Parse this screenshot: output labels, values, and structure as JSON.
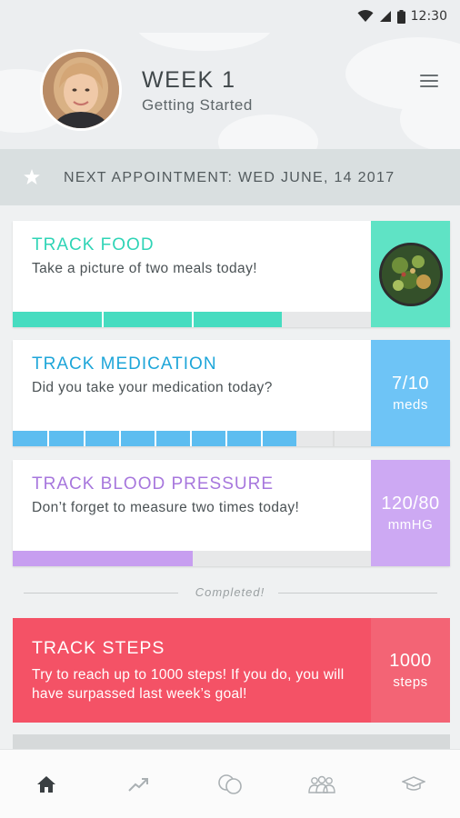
{
  "status_bar": {
    "time": "12:30",
    "icons": [
      "wifi-icon",
      "signal-icon",
      "battery-icon"
    ]
  },
  "header": {
    "week_title": "WEEK 1",
    "week_subtitle": "Getting Started",
    "menu_icon": "hamburger-menu-icon"
  },
  "appointment": {
    "icon": "star-icon",
    "text": "NEXT APPOINTMENT: WED JUNE, 14 2017"
  },
  "cards": [
    {
      "title": "TRACK FOOD",
      "description": "Take a picture of two meals today!",
      "accent": "#3ddbbf",
      "side_color": "#5fe3c5",
      "progress": {
        "segments": 4,
        "filled": 3,
        "fraction": 0.75
      }
    },
    {
      "title": "TRACK MEDICATION",
      "description": "Did you take your medication today?",
      "accent": "#20a8dc",
      "bar_color": "#5dbdf0",
      "side_color": "#6ec4f6",
      "side_value": "7/10",
      "side_unit": "meds",
      "progress": {
        "segments": 10,
        "filled": 8,
        "fraction": 0.8
      }
    },
    {
      "title": "TRACK BLOOD PRESSURE",
      "description": "Don’t forget to measure two times today!",
      "accent": "#a978de",
      "bar_color": "#c79ef0",
      "side_color": "#cda9f3",
      "side_value": "120/80",
      "side_unit": "mmHG",
      "progress": {
        "segments": 2,
        "filled": 1,
        "fraction": 0.5
      }
    }
  ],
  "divider_label": "Completed!",
  "steps_card": {
    "title": "TRACK  STEPS",
    "description": "Try to reach up to 1000 steps! If you do, you will have surpassed last week’s goal!",
    "side_value": "1000",
    "side_unit": "steps",
    "color": "#f45266"
  },
  "bottom_nav": [
    {
      "icon": "home-icon",
      "active": true
    },
    {
      "icon": "trending-up-icon",
      "active": false
    },
    {
      "icon": "chat-bubbles-icon",
      "active": false
    },
    {
      "icon": "group-icon",
      "active": false
    },
    {
      "icon": "graduation-cap-icon",
      "active": false
    }
  ]
}
